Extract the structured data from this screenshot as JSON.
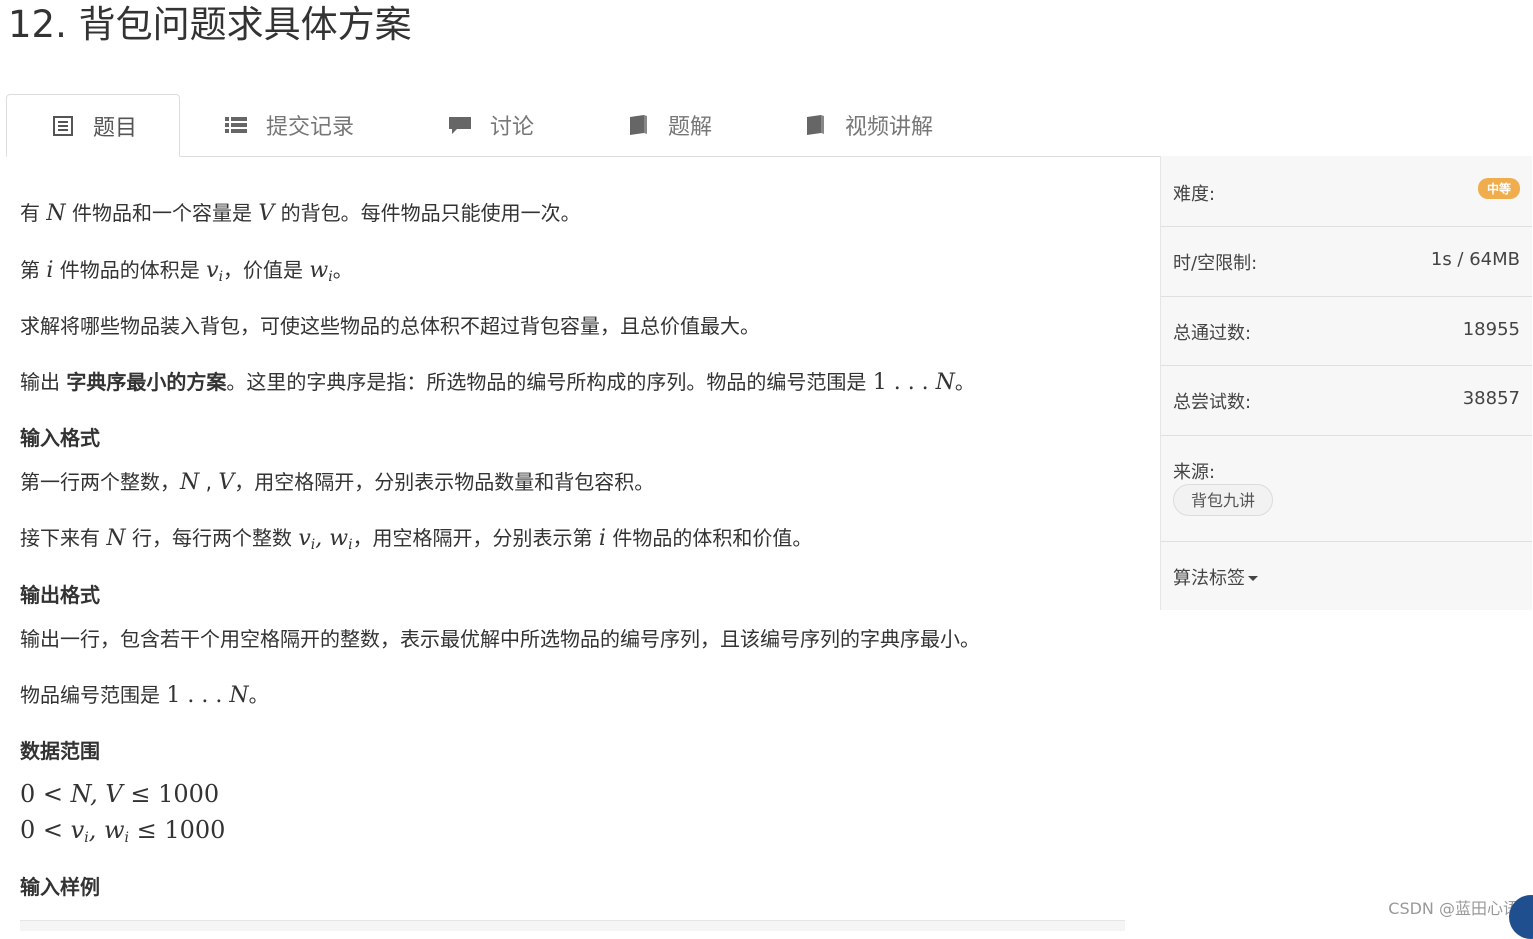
{
  "title": "12. 背包问题求具体方案",
  "tabs": [
    {
      "label": "题目",
      "icon": "list-icon",
      "active": true
    },
    {
      "label": "提交记录",
      "icon": "list-icon"
    },
    {
      "label": "讨论",
      "icon": "comment-icon"
    },
    {
      "label": "题解",
      "icon": "book-icon"
    },
    {
      "label": "视频讲解",
      "icon": "book-icon"
    }
  ],
  "problem": {
    "p1": {
      "a": "有 ",
      "m1": "N",
      "b": " 件物品和一个容量是 ",
      "m2": "V",
      "c": " 的背包。每件物品只能使用一次。"
    },
    "p2": {
      "a": "第 ",
      "m1": "i",
      "b": " 件物品的体积是 ",
      "m2": "v",
      "s2": "i",
      "c": "，价值是 ",
      "m3": "w",
      "s3": "i",
      "d": "。"
    },
    "p3": "求解将哪些物品装入背包，可使这些物品的总体积不超过背包容量，且总价值最大。",
    "p4": {
      "a": "输出 ",
      "bold": "字典序最小的方案",
      "b": "。这里的字典序是指：所选物品的编号所构成的序列。物品的编号范围是 ",
      "n": "1 . . . ",
      "m": "N",
      "c": "。"
    },
    "h_input": "输入格式",
    "p5": {
      "a": "第一行两个整数，",
      "m1": "N",
      "b": " , ",
      "m2": "V",
      "c": "，用空格隔开，分别表示物品数量和背包容积。"
    },
    "p6": {
      "a": "接下来有 ",
      "m1": "N",
      "b": " 行，每行两个整数 ",
      "m2": "v",
      "s2": "i",
      "m3": ", w",
      "s3": "i",
      "c": "，用空格隔开，分别表示第 ",
      "m4": "i",
      "d": " 件物品的体积和价值。"
    },
    "h_output": "输出格式",
    "p7": "输出一行，包含若干个用空格隔开的整数，表示最优解中所选物品的编号序列，且该编号序列的字典序最小。",
    "p8": {
      "a": "物品编号范围是 ",
      "n": "1 . . . ",
      "m": "N",
      "c": "。"
    },
    "h_range": "数据范围",
    "r1": {
      "a": "0 < ",
      "m": "N, V",
      "b": " ≤ 1000"
    },
    "r2": {
      "a": "0 < ",
      "m1": "v",
      "s1": "i",
      "m2": ", w",
      "s2": "i",
      "b": " ≤ 1000"
    },
    "h_sample": "输入样例"
  },
  "sidebar": {
    "difficulty_label": "难度:",
    "difficulty_value": "中等",
    "limit_label": "时/空限制:",
    "limit_value": "1s / 64MB",
    "passed_label": "总通过数:",
    "passed_value": "18955",
    "tried_label": "总尝试数:",
    "tried_value": "38857",
    "source_label": "来源:",
    "source_tag": "背包九讲",
    "algo_label": "算法标签"
  },
  "watermark": "CSDN @蓝田心语",
  "colors": {
    "badge": "#f0ad4e",
    "sidebar_bg": "#f7f7f7",
    "text": "#333333"
  }
}
